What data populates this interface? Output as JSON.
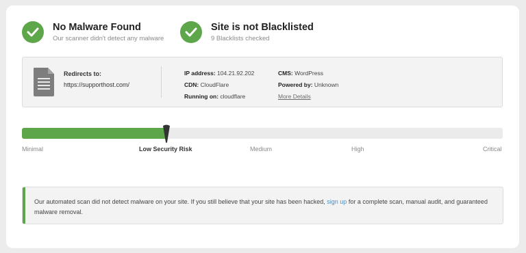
{
  "status": {
    "malware": {
      "title": "No Malware Found",
      "subtitle": "Our scanner didn't detect any malware"
    },
    "blacklist": {
      "title": "Site is not Blacklisted",
      "subtitle": "9 Blacklists checked"
    }
  },
  "info": {
    "redirects_label": "Redirects to:",
    "redirects_value": "https://supporthost.com/",
    "ip_label": "IP address:",
    "ip_value": "104.21.92.202",
    "cdn_label": "CDN:",
    "cdn_value": "CloudFlare",
    "running_label": "Running on:",
    "running_value": "cloudflare",
    "cms_label": "CMS:",
    "cms_value": "WordPress",
    "powered_label": "Powered by:",
    "powered_value": "Unknown",
    "more_details": "More Details"
  },
  "risk": {
    "level_fraction": 0.3,
    "labels": {
      "minimal": "Minimal",
      "low": "Low Security Risk",
      "medium": "Medium",
      "high": "High",
      "critical": "Critical"
    },
    "active_level": "low"
  },
  "notice": {
    "text_before": "Our automated scan did not detect malware on your site. If you still believe that your site has been hacked,",
    "link_text": "sign up",
    "text_after": "for a complete scan, manual audit, and guaranteed malware removal."
  },
  "colors": {
    "accent_green": "#5ea64a",
    "link_blue": "#4a8fc0",
    "marker": "#333333"
  },
  "icons": {
    "malware_status": "check-circle-icon",
    "blacklist_status": "check-circle-icon",
    "info": "document-icon",
    "risk_marker": "risk-marker-icon"
  }
}
